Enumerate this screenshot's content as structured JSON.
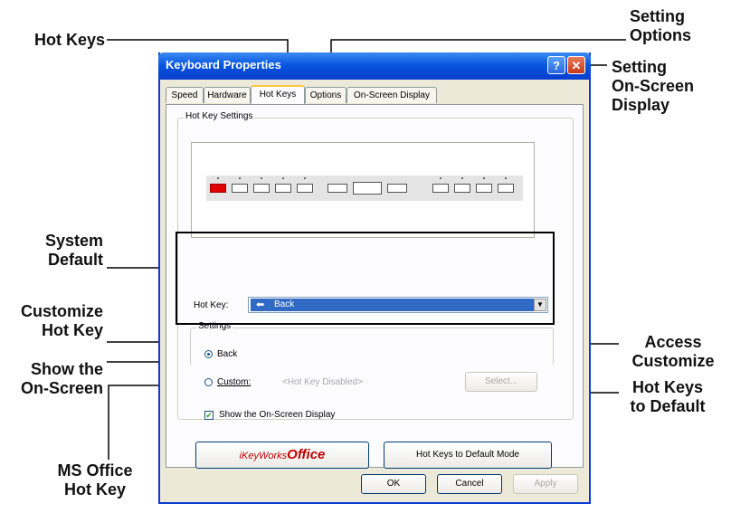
{
  "callouts": {
    "hot_keys": "Hot Keys",
    "setting_options": [
      "Setting",
      "Options"
    ],
    "setting_osd": [
      "Setting",
      "On-Screen",
      "Display"
    ],
    "system_default": [
      "System",
      "Default"
    ],
    "customize_hot_key": [
      "Customize",
      "Hot Key"
    ],
    "show_onscreen": [
      "Show the",
      "On-Screen"
    ],
    "ms_office": [
      "MS Office",
      "Hot Key"
    ],
    "access_customize": [
      "Access",
      "Customize"
    ],
    "hot_keys_default": [
      "Hot Keys",
      "to Default"
    ]
  },
  "window": {
    "title": "Keyboard Properties",
    "help_glyph": "?",
    "close_glyph": "✕",
    "tabs": [
      "Speed",
      "Hardware",
      "Hot Keys",
      "Options",
      "On-Screen Display"
    ],
    "active_tab": "Hot Keys"
  },
  "hotkey_settings": {
    "group_label": "Hot Key Settings",
    "hotkey_label": "Hot Key:",
    "hotkey_value": "Back",
    "settings_label": "Settings",
    "radio_back": "Back",
    "radio_custom": "Custom:",
    "custom_value": "<Hot Key Disabled>",
    "select_button": "Select...",
    "show_osd": "Show the On-Screen Display",
    "ikeyworks_prefix": "iKeyWorks",
    "ikeyworks_office": "Office",
    "default_mode_button": "Hot Keys to Default Mode"
  },
  "footer": {
    "ok": "OK",
    "cancel": "Cancel",
    "apply": "Apply"
  },
  "colors": {
    "title_blue": "#0a57e0",
    "selection": "#316ac5",
    "accent_red": "#e00000"
  }
}
